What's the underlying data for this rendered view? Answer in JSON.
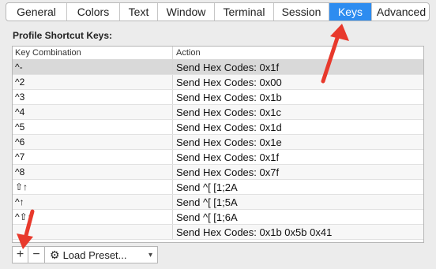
{
  "tabs": [
    {
      "label": "General",
      "selected": false
    },
    {
      "label": "Colors",
      "selected": false
    },
    {
      "label": "Text",
      "selected": false
    },
    {
      "label": "Window",
      "selected": false
    },
    {
      "label": "Terminal",
      "selected": false
    },
    {
      "label": "Session",
      "selected": false
    },
    {
      "label": "Keys",
      "selected": true
    },
    {
      "label": "Advanced",
      "selected": false
    }
  ],
  "section_title": "Profile Shortcut Keys:",
  "table": {
    "columns": [
      "Key Combination",
      "Action"
    ],
    "rows": [
      {
        "key": "^-",
        "action": "Send Hex Codes: 0x1f",
        "selected": true
      },
      {
        "key": "^2",
        "action": "Send Hex Codes: 0x00"
      },
      {
        "key": "^3",
        "action": "Send Hex Codes: 0x1b"
      },
      {
        "key": "^4",
        "action": "Send Hex Codes: 0x1c"
      },
      {
        "key": "^5",
        "action": "Send Hex Codes: 0x1d"
      },
      {
        "key": "^6",
        "action": "Send Hex Codes: 0x1e"
      },
      {
        "key": "^7",
        "action": "Send Hex Codes: 0x1f"
      },
      {
        "key": "^8",
        "action": "Send Hex Codes: 0x7f"
      },
      {
        "key": "⇧↑",
        "action": "Send ^[ [1;2A"
      },
      {
        "key": "^↑",
        "action": "Send ^[ [1;5A"
      },
      {
        "key": "^⇧↑",
        "action": "Send ^[ [1;6A"
      },
      {
        "key": "",
        "action": "Send Hex Codes: 0x1b 0x5b 0x41"
      }
    ]
  },
  "bottom_bar": {
    "add_label": "+",
    "remove_label": "−",
    "preset_label": "Load Preset...",
    "preset_icon": "gear-icon",
    "preset_chevron": "chevron-down-icon"
  },
  "colors": {
    "selected_tab": "#2d8cf0",
    "arrow": "#e8392c"
  }
}
